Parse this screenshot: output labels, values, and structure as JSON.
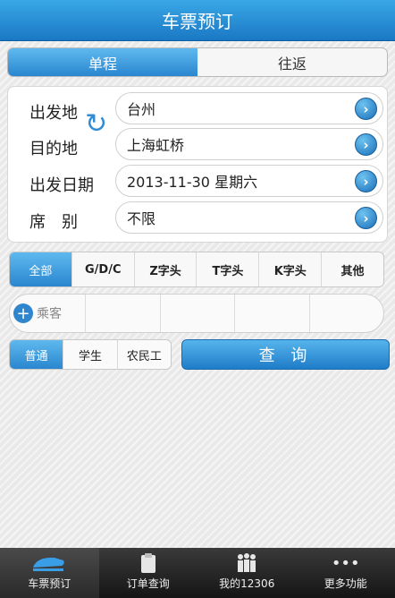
{
  "header": {
    "title": "车票预订"
  },
  "trip_type": {
    "options": [
      "单程",
      "往返"
    ],
    "selected": "单程"
  },
  "form": {
    "departure": {
      "label": "出发地",
      "value": "台州"
    },
    "destination": {
      "label": "目的地",
      "value": "上海虹桥"
    },
    "date": {
      "label": "出发日期",
      "value": "2013-11-30 星期六"
    },
    "seat": {
      "label": "席　别",
      "value": "不限"
    }
  },
  "train_types": {
    "options": [
      "全部",
      "G/D/C",
      "Z字头",
      "T字头",
      "K字头",
      "其他"
    ],
    "selected": "全部"
  },
  "passenger": {
    "add_label": "乘客"
  },
  "ticket_types": {
    "options": [
      "普通",
      "学生",
      "农民工"
    ],
    "selected": "普通"
  },
  "query_button": {
    "label": "查 询"
  },
  "bottom_nav": {
    "items": [
      "车票预订",
      "订单查询",
      "我的12306",
      "更多功能"
    ],
    "selected": "车票预订"
  },
  "colors": {
    "primary_blue": "#2a86cf",
    "header_blue": "#1b78c4",
    "nav_dark": "#1a1a1a"
  }
}
